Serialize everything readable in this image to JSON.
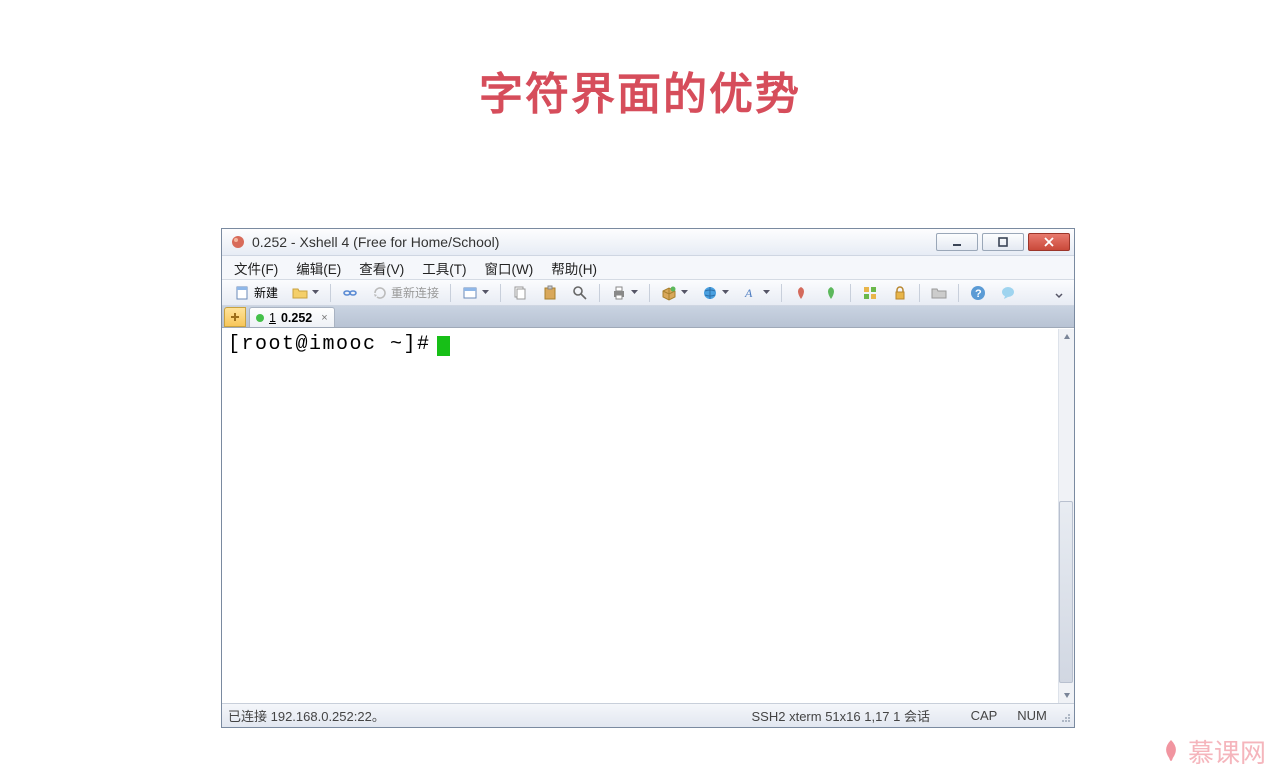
{
  "slide": {
    "title": "字符界面的优势"
  },
  "window": {
    "title": "0.252 - Xshell 4 (Free for Home/School)"
  },
  "menu": {
    "file": "文件(F)",
    "edit": "编辑(E)",
    "view": "查看(V)",
    "tools": "工具(T)",
    "window": "窗口(W)",
    "help": "帮助(H)"
  },
  "toolbar": {
    "new_label": "新建",
    "reconnect_label": "重新连接"
  },
  "tab": {
    "index": "1",
    "label": "0.252",
    "close": "×"
  },
  "terminal": {
    "prompt": "[root@imooc ~]#"
  },
  "status": {
    "left": "已连接 192.168.0.252:22。",
    "mid": "SSH2  xterm  51x16  1,17  1 会话",
    "cap": "CAP",
    "num": "NUM"
  },
  "watermark": {
    "text": "慕课网"
  }
}
